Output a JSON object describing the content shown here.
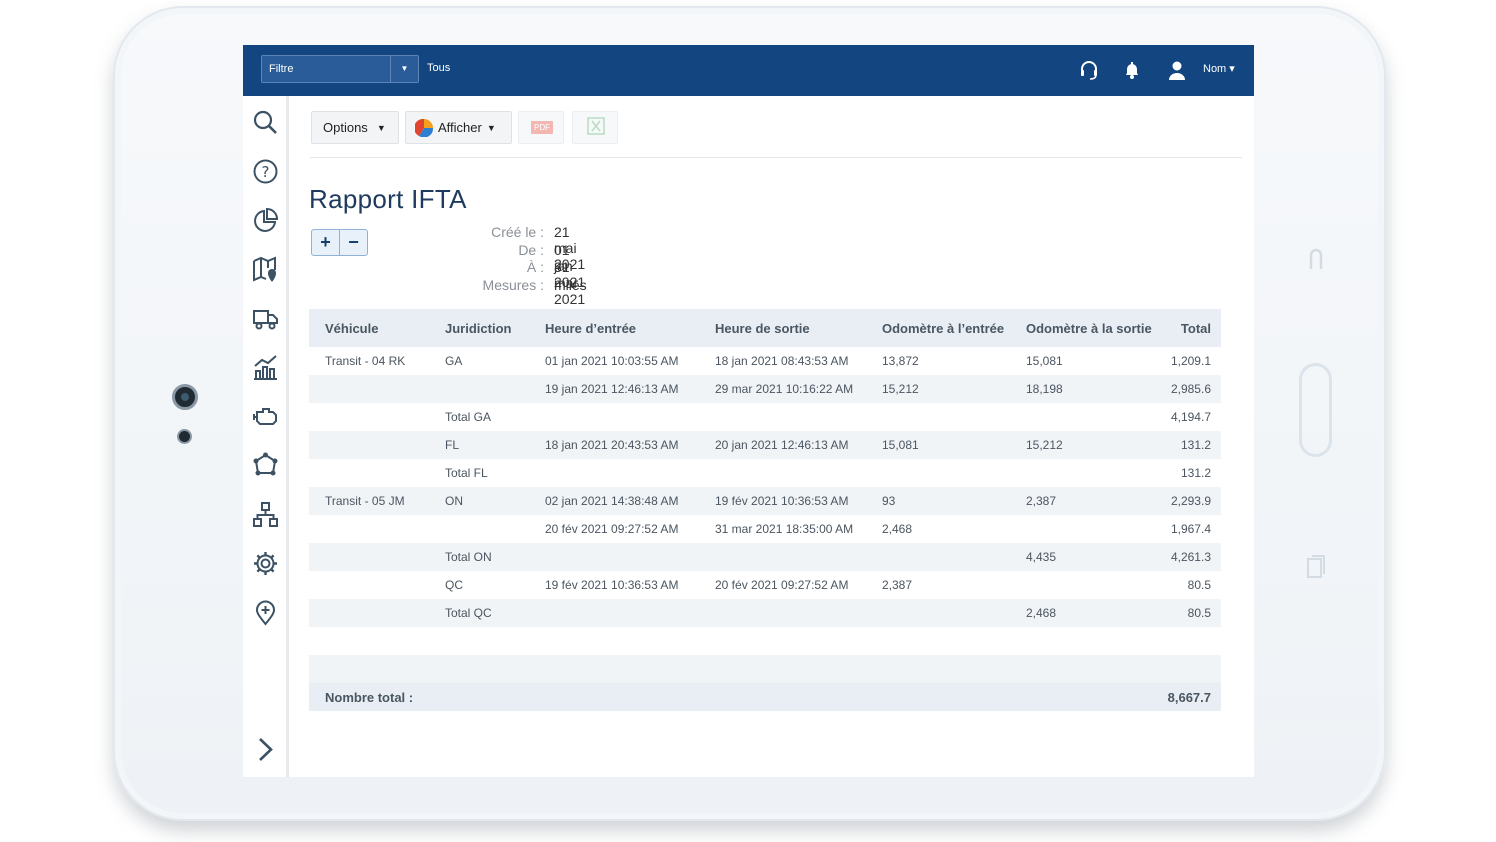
{
  "topbar": {
    "filter_label": "Filtre",
    "filter_value": "Tous",
    "user_label": "Nom ▾",
    "icons": [
      "headset-icon",
      "bell-icon",
      "user-icon"
    ]
  },
  "sidebar": {
    "items": [
      "search-icon",
      "help-icon",
      "pie-chart-icon",
      "map-icon",
      "truck-icon",
      "chart-icon",
      "engine-icon",
      "network-icon",
      "hierarchy-icon",
      "gear-icon",
      "location-icon"
    ],
    "expand_icon": "chevron-right-icon"
  },
  "toolbar": {
    "options_label": "Options",
    "afficher_label": "Afficher",
    "pdf_label": "PDF"
  },
  "report": {
    "title": "Rapport IFTA",
    "expand_label": "+",
    "collapse_label": "−",
    "meta": [
      {
        "key": "Créé le :",
        "value": "21 mai 2021"
      },
      {
        "key": "De :",
        "value": "01 jan 2021"
      },
      {
        "key": "À :",
        "value": "31 mar 2021"
      },
      {
        "key": "Mesures :",
        "value": "miles"
      }
    ]
  },
  "table": {
    "headers": [
      "Véhicule",
      "Juridiction",
      "Heure d’entrée",
      "Heure de sortie",
      "Odomètre à l’entrée",
      "Odomètre à la sortie",
      "Total"
    ],
    "rows": [
      [
        "Transit - 04 RK",
        "GA",
        "01 jan 2021 10:03:55 AM",
        "18 jan 2021 08:43:53 AM",
        "13,872",
        "15,081",
        "1,209.1"
      ],
      [
        "",
        "",
        "19 jan 2021 12:46:13 AM",
        "29 mar 2021 10:16:22 AM",
        "15,212",
        "18,198",
        "2,985.6"
      ],
      [
        "",
        "Total GA",
        "",
        "",
        "",
        "",
        "4,194.7"
      ],
      [
        "",
        "FL",
        "18 jan 2021 20:43:53 AM",
        "20 jan 2021 12:46:13 AM",
        "15,081",
        "15,212",
        "131.2"
      ],
      [
        "",
        "Total FL",
        "",
        "",
        "",
        "",
        "131.2"
      ],
      [
        "Transit - 05 JM",
        "ON",
        "02 jan 2021 14:38:48 AM",
        "19 fév 2021 10:36:53 AM",
        "93",
        "2,387",
        "2,293.9"
      ],
      [
        "",
        "",
        "20 fév 2021 09:27:52 AM",
        "31 mar 2021 18:35:00 AM",
        "2,468",
        "",
        "1,967.4"
      ],
      [
        "",
        "Total ON",
        "",
        "",
        "",
        "4,435",
        "4,261.3"
      ],
      [
        "",
        "QC",
        "19 fév 2021 10:36:53 AM",
        "20 fév 2021 09:27:52 AM",
        "2,387",
        "",
        "80.5"
      ],
      [
        "",
        "Total QC",
        "",
        "",
        "",
        "2,468",
        "80.5"
      ]
    ],
    "total_label": "Nombre total :",
    "total_value": "8,667.7"
  },
  "colors": {
    "topbar": "#134580",
    "title": "#1e3a5e",
    "row_alt": "#f1f4f7",
    "header_bg": "#e8eef3"
  }
}
